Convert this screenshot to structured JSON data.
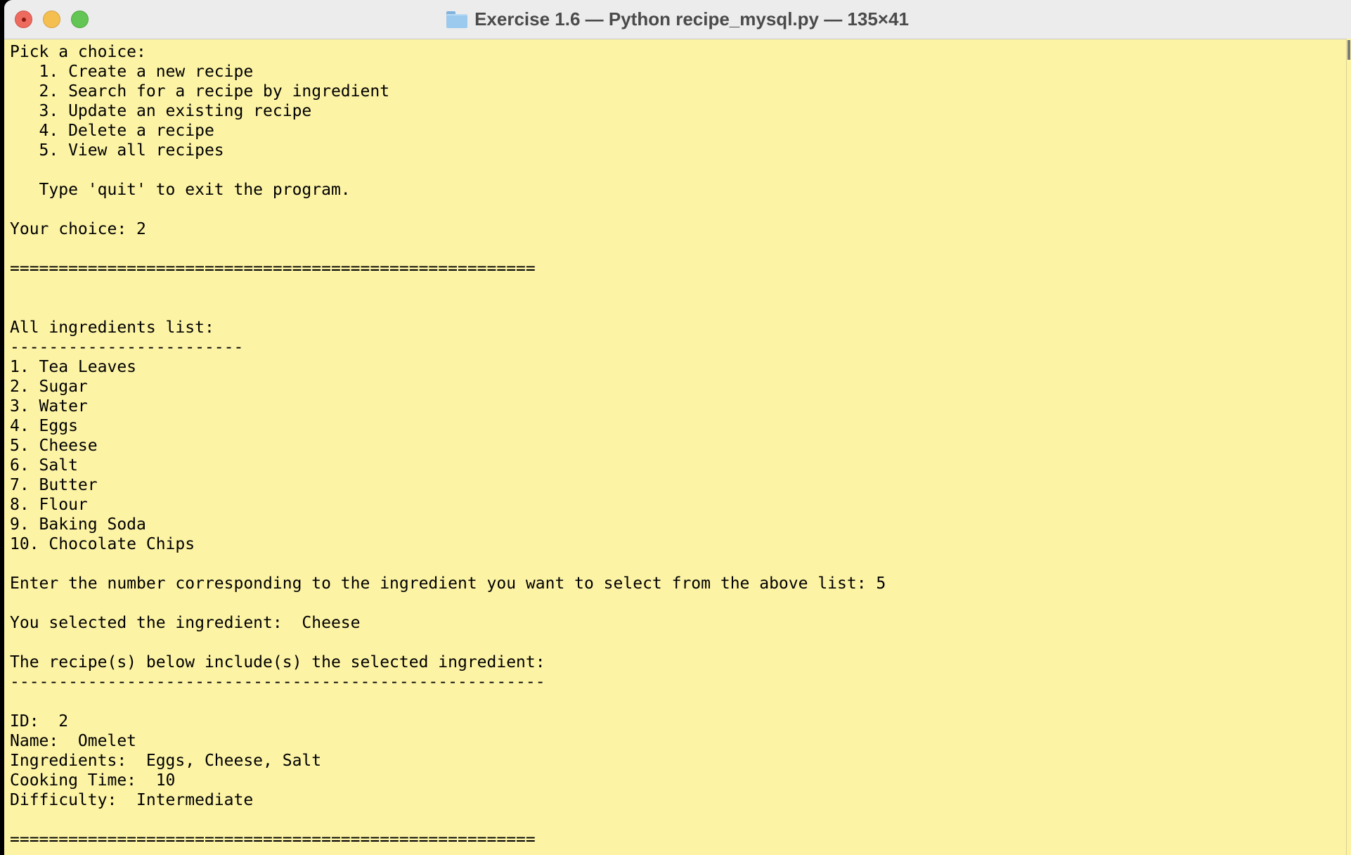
{
  "window": {
    "title": "Exercise 1.6 — Python recipe_mysql.py — 135×41",
    "background_color": "#fcf3a5",
    "folder_icon": "folder-icon"
  },
  "terminal": {
    "lines": [
      "Pick a choice:",
      "   1. Create a new recipe",
      "   2. Search for a recipe by ingredient",
      "   3. Update an existing recipe",
      "   4. Delete a recipe",
      "   5. View all recipes",
      "",
      "   Type 'quit' to exit the program.",
      "",
      "Your choice: 2",
      "",
      "======================================================",
      "",
      "",
      "All ingredients list:",
      "------------------------",
      "1. Tea Leaves",
      "2. Sugar",
      "3. Water",
      "4. Eggs",
      "5. Cheese",
      "6. Salt",
      "7. Butter",
      "8. Flour",
      "9. Baking Soda",
      "10. Chocolate Chips",
      "",
      "Enter the number corresponding to the ingredient you want to select from the above list: 5",
      "",
      "You selected the ingredient:  Cheese",
      "",
      "The recipe(s) below include(s) the selected ingredient:",
      "-------------------------------------------------------",
      "",
      "ID:  2",
      "Name:  Omelet",
      "Ingredients:  Eggs, Cheese, Salt",
      "Cooking Time:  10",
      "Difficulty:  Intermediate",
      "",
      "======================================================"
    ]
  }
}
